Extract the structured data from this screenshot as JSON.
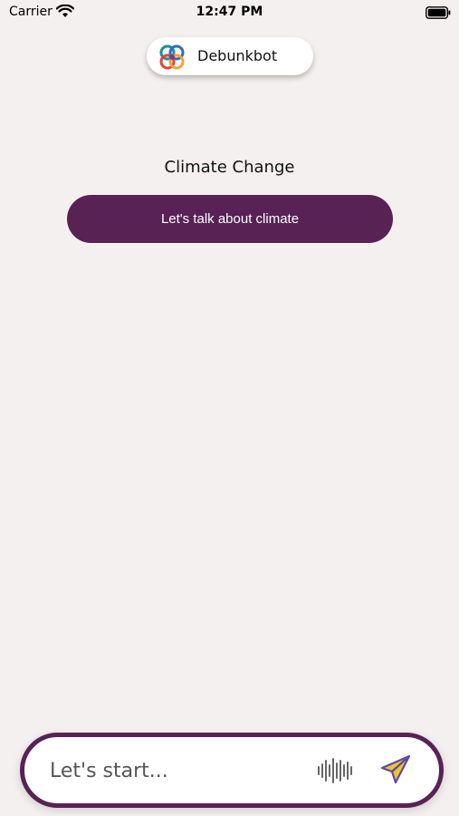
{
  "status_bar": {
    "carrier": "Carrier",
    "time": "12:47 PM"
  },
  "app": {
    "name": "Debunkbot"
  },
  "topic": {
    "title": "Climate Change",
    "button_label": "Let's talk about climate"
  },
  "composer": {
    "placeholder": "Let's start..."
  },
  "colors": {
    "accent": "#582255",
    "background": "#f4f0f0",
    "send_fill": "#f2c12e",
    "send_stroke": "#5b4aa8"
  },
  "icons": {
    "wifi": "wifi-icon",
    "battery": "battery-icon",
    "logo": "debunkbot-logo-icon",
    "voice": "voice-waveform-icon",
    "send": "send-paper-plane-icon"
  }
}
